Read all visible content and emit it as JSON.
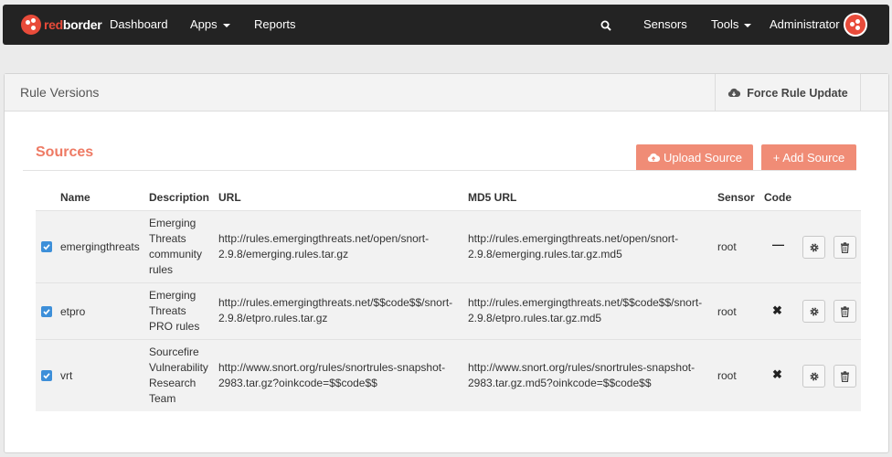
{
  "navbar": {
    "logo_red": "red",
    "logo_white": "border",
    "dashboard": "Dashboard",
    "apps": "Apps",
    "reports": "Reports",
    "sensors": "Sensors",
    "tools": "Tools",
    "user": "Administrator",
    "icons": {
      "search": "search-icon",
      "avatar": "avatar-icon"
    }
  },
  "panel": {
    "title": "Rule Versions",
    "force_update": "Force Rule Update"
  },
  "sources": {
    "title": "Sources",
    "upload_label": "Upload Source",
    "add_label": "+ Add Source",
    "columns": [
      "Name",
      "Description",
      "URL",
      "MD5 URL",
      "Sensor",
      "Code"
    ],
    "rows": [
      {
        "checked": true,
        "name": "emergingthreats",
        "description": [
          "Emerging",
          "Threats",
          "community",
          "rules"
        ],
        "url": [
          "http://rules.emergingthreats.net/open/snort-",
          "2.9.8/emerging.rules.tar.gz"
        ],
        "md5_url": [
          "http://rules.emergingthreats.net/open/snort-",
          "2.9.8/emerging.rules.tar.gz.md5"
        ],
        "sensor": "root",
        "code": "—"
      },
      {
        "checked": true,
        "name": "etpro",
        "description": [
          "Emerging",
          "Threats",
          "PRO rules"
        ],
        "url": [
          "http://rules.emergingthreats.net/$$code$$/snort-",
          "2.9.8/etpro.rules.tar.gz"
        ],
        "md5_url": [
          "http://rules.emergingthreats.net/$$code$$/snort-",
          "2.9.8/etpro.rules.tar.gz.md5"
        ],
        "sensor": "root",
        "code": "✖"
      },
      {
        "checked": true,
        "name": "vrt",
        "description": [
          "Sourcefire",
          "Vulnerability",
          "Research",
          "Team"
        ],
        "url": [
          "http://www.snort.org/rules/snortrules-snapshot-",
          "2983.tar.gz?oinkcode=$$code$$"
        ],
        "md5_url": [
          "http://www.snort.org/rules/snortrules-snapshot-",
          "2983.tar.gz.md5?oinkcode=$$code$$"
        ],
        "sensor": "root",
        "code": "✖"
      }
    ]
  },
  "colors": {
    "accent": "#ee7a64",
    "button": "#f08c76",
    "navbar": "#232323",
    "checkbox": "#3d8fd9"
  }
}
